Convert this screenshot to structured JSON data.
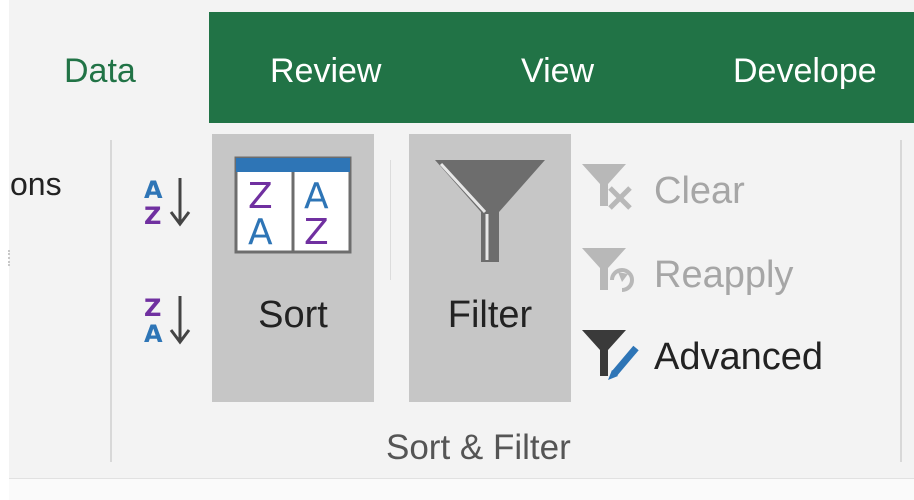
{
  "tabs": [
    {
      "label": "Data",
      "active": true
    },
    {
      "label": "Review",
      "active": false
    },
    {
      "label": "View",
      "active": false
    },
    {
      "label": "Develope",
      "active": false
    }
  ],
  "previous_group": {
    "label_fragment": "ons"
  },
  "sort_filter_group": {
    "label": "Sort & Filter",
    "sort_button": {
      "label": "Sort",
      "icon": "sort-dialog-icon"
    },
    "filter_button": {
      "label": "Filter",
      "icon": "funnel-icon"
    },
    "sort_az": {
      "icon": "sort-a-to-z-icon",
      "top": "A",
      "bottom": "Z"
    },
    "sort_za": {
      "icon": "sort-z-to-a-icon",
      "top": "Z",
      "bottom": "A"
    },
    "commands": {
      "clear": {
        "label": "Clear",
        "enabled": false,
        "icon": "clear-filter-icon"
      },
      "reapply": {
        "label": "Reapply",
        "enabled": false,
        "icon": "reapply-filter-icon"
      },
      "advanced": {
        "label": "Advanced",
        "enabled": true,
        "icon": "advanced-filter-icon"
      }
    }
  },
  "colors": {
    "accent_green": "#217346",
    "ribbon_bg": "#f3f3f3",
    "button_pressed": "#c6c6c6",
    "letter_blue": "#2e75b6",
    "letter_purple": "#7030a0",
    "disabled_text": "#a6a6a6"
  }
}
